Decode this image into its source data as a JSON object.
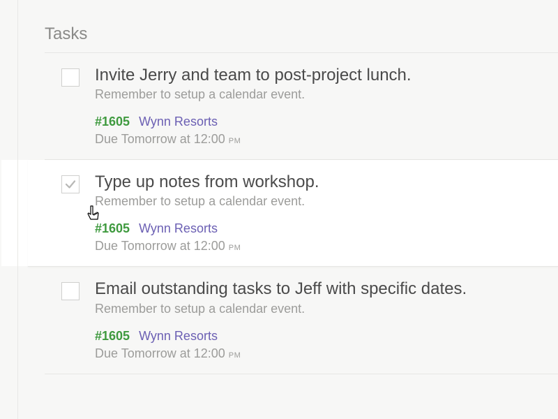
{
  "section_title": "Tasks",
  "tasks": [
    {
      "title": "Invite Jerry and team to post-project lunch.",
      "note": "Remember to setup a calendar event.",
      "id": "#1605",
      "project": "Wynn Resorts",
      "due_prefix": "Due Tomorrow at 12:00 ",
      "due_suffix": "pm",
      "checked": false,
      "active": false
    },
    {
      "title": "Type up notes from workshop.",
      "note": "Remember to setup a calendar event.",
      "id": "#1605",
      "project": "Wynn Resorts",
      "due_prefix": "Due Tomorrow at 12:00 ",
      "due_suffix": "pm",
      "checked": true,
      "active": true
    },
    {
      "title": "Email outstanding tasks to Jeff with specific dates.",
      "note": "Remember to setup a calendar event.",
      "id": "#1605",
      "project": "Wynn Resorts",
      "due_prefix": "Due Tomorrow at 12:00 ",
      "due_suffix": "pm",
      "checked": false,
      "active": false
    }
  ]
}
